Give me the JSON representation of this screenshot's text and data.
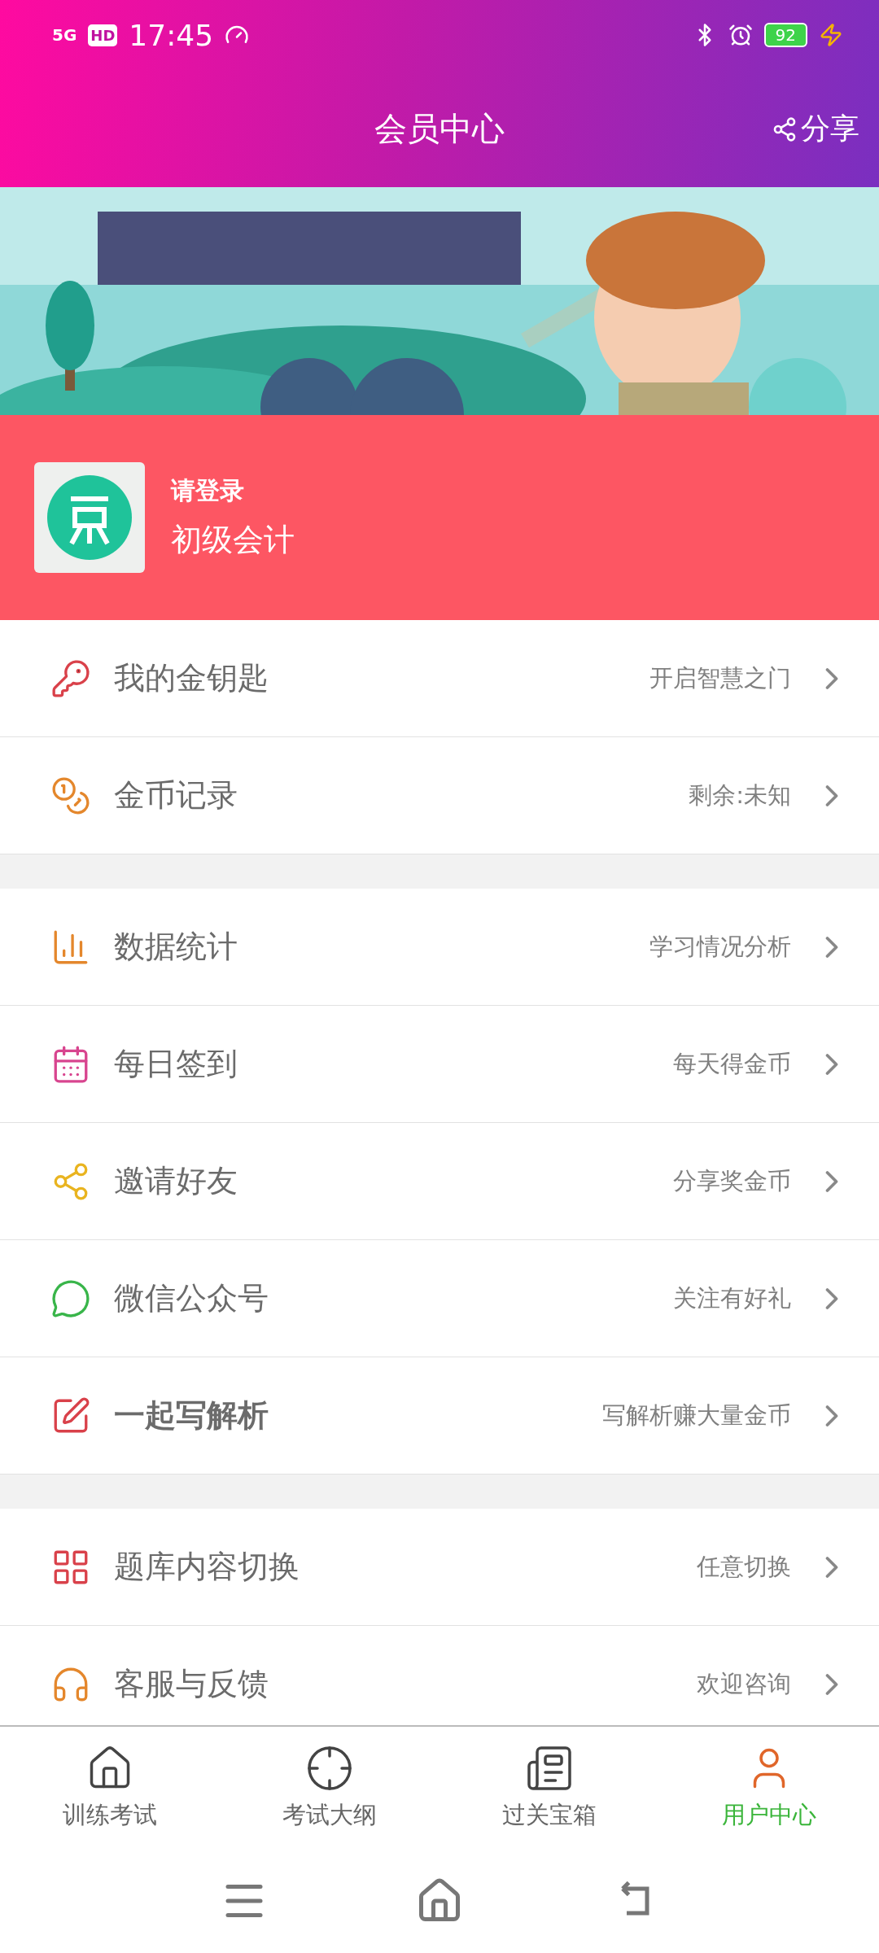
{
  "status_bar": {
    "network": "5G",
    "hd": "HD",
    "time": "17:45",
    "battery": "92"
  },
  "header": {
    "title": "会员中心",
    "share": "分享"
  },
  "profile": {
    "login": "请登录",
    "subject": "初级会计"
  },
  "sections": [
    {
      "rows": [
        {
          "label": "我的金钥匙",
          "hint": "开启智慧之门",
          "bold": false
        },
        {
          "label": "金币记录",
          "hint": "剩余:未知",
          "bold": false
        }
      ]
    },
    {
      "rows": [
        {
          "label": "数据统计",
          "hint": "学习情况分析",
          "bold": false
        },
        {
          "label": "每日签到",
          "hint": "每天得金币",
          "bold": false
        },
        {
          "label": "邀请好友",
          "hint": "分享奖金币",
          "bold": false
        },
        {
          "label": "微信公众号",
          "hint": "关注有好礼",
          "bold": false
        },
        {
          "label": "一起写解析",
          "hint": "写解析赚大量金币",
          "bold": true
        }
      ]
    },
    {
      "rows": [
        {
          "label": "题库内容切换",
          "hint": "任意切换",
          "bold": false
        },
        {
          "label": "客服与反馈",
          "hint": "欢迎咨询",
          "bold": false
        }
      ]
    }
  ],
  "tabs": [
    {
      "label": "训练考试",
      "selected": false
    },
    {
      "label": "考试大纲",
      "selected": false
    },
    {
      "label": "过关宝箱",
      "selected": false
    },
    {
      "label": "用户中心",
      "selected": true
    }
  ]
}
